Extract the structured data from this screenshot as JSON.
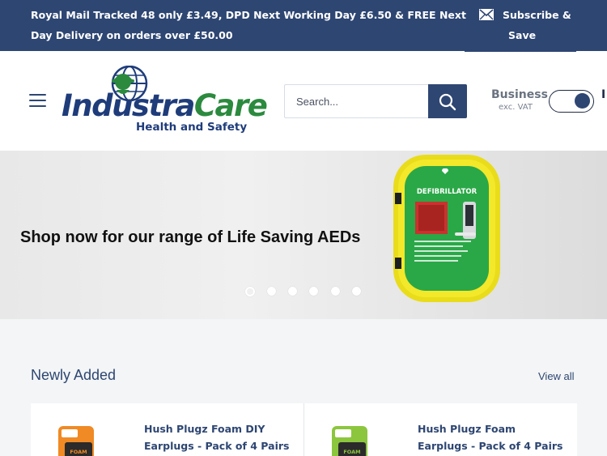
{
  "announcement": {
    "text": "Royal Mail Tracked 48 only £3.49, DPD Next Working Day £6.50 & FREE Next Day Delivery on orders over £50.00",
    "subscribe_line1": "Subscribe &",
    "subscribe_line2": "Save"
  },
  "header": {
    "logo_part1": "Industra",
    "logo_part2": "Care",
    "logo_tagline": "Health and Safety",
    "search_placeholder": "Search...",
    "business_label": "Business",
    "business_sub": "exc. VAT",
    "inc_label": "I"
  },
  "hero": {
    "headline": "Shop now for our range of Life Saving AEDs",
    "aed_label": "DEFIBRILLATOR",
    "slide_count": 6,
    "active_slide": 1
  },
  "newly_added": {
    "title": "Newly Added",
    "view_all": "View all",
    "products": [
      {
        "title": "Hush Plugz Foam DIY Earplugs - Pack of 4 Pairs",
        "box_label": "FOAM"
      },
      {
        "title": "Hush Plugz Foam Earplugs - Pack of 4 Pairs",
        "box_label": "FOAM"
      }
    ]
  },
  "colors": {
    "brand_navy": "#2e4672",
    "brand_green": "#2b8a3e",
    "aed_yellow": "#f2e21d",
    "aed_green": "#27a844"
  },
  "icons": [
    "mail-icon",
    "menu-icon",
    "search-icon",
    "globe-icon"
  ]
}
